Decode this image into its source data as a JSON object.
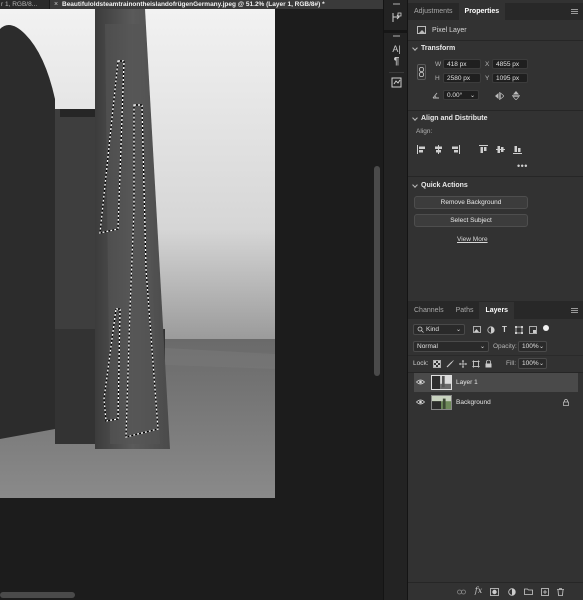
{
  "document_tabs": [
    {
      "label": "r 1, RGB/8..."
    },
    {
      "label": "BeautifuloldsteamtrainontheislandofrügenGermany.jpeg @ 51.2% (Layer 1, RGB/8#) *"
    }
  ],
  "panel_tabs_top": [
    {
      "label": "Adjustments",
      "active": false
    },
    {
      "label": "Properties",
      "active": true
    }
  ],
  "properties": {
    "layer_type": "Pixel Layer",
    "transform": {
      "title": "Transform",
      "w_label": "W",
      "w_value": "418 px",
      "h_label": "H",
      "h_value": "2580 px",
      "x_label": "X",
      "x_value": "4855 px",
      "y_label": "Y",
      "y_value": "1095 px",
      "angle_value": "0.00°"
    },
    "align": {
      "title": "Align and Distribute",
      "label": "Align:"
    },
    "quick_actions": {
      "title": "Quick Actions",
      "remove_bg": "Remove Background",
      "select_subject": "Select Subject",
      "view_more": "View More"
    }
  },
  "panel_tabs_bottom": [
    {
      "label": "Channels",
      "active": false
    },
    {
      "label": "Paths",
      "active": false
    },
    {
      "label": "Layers",
      "active": true
    }
  ],
  "layers_panel": {
    "filter_kind": "Kind",
    "blend_mode": "Normal",
    "opacity_label": "Opacity:",
    "opacity_value": "100%",
    "lock_label": "Lock:",
    "fill_label": "Fill:",
    "fill_value": "100%",
    "layers": [
      {
        "name": "Layer 1",
        "selected": true,
        "locked": false
      },
      {
        "name": "Background",
        "selected": false,
        "locked": true
      }
    ]
  },
  "colors": {
    "panel_bg": "#323232",
    "selected_row": "#4a4a4a",
    "canvas_bg": "#1c1c1c"
  }
}
